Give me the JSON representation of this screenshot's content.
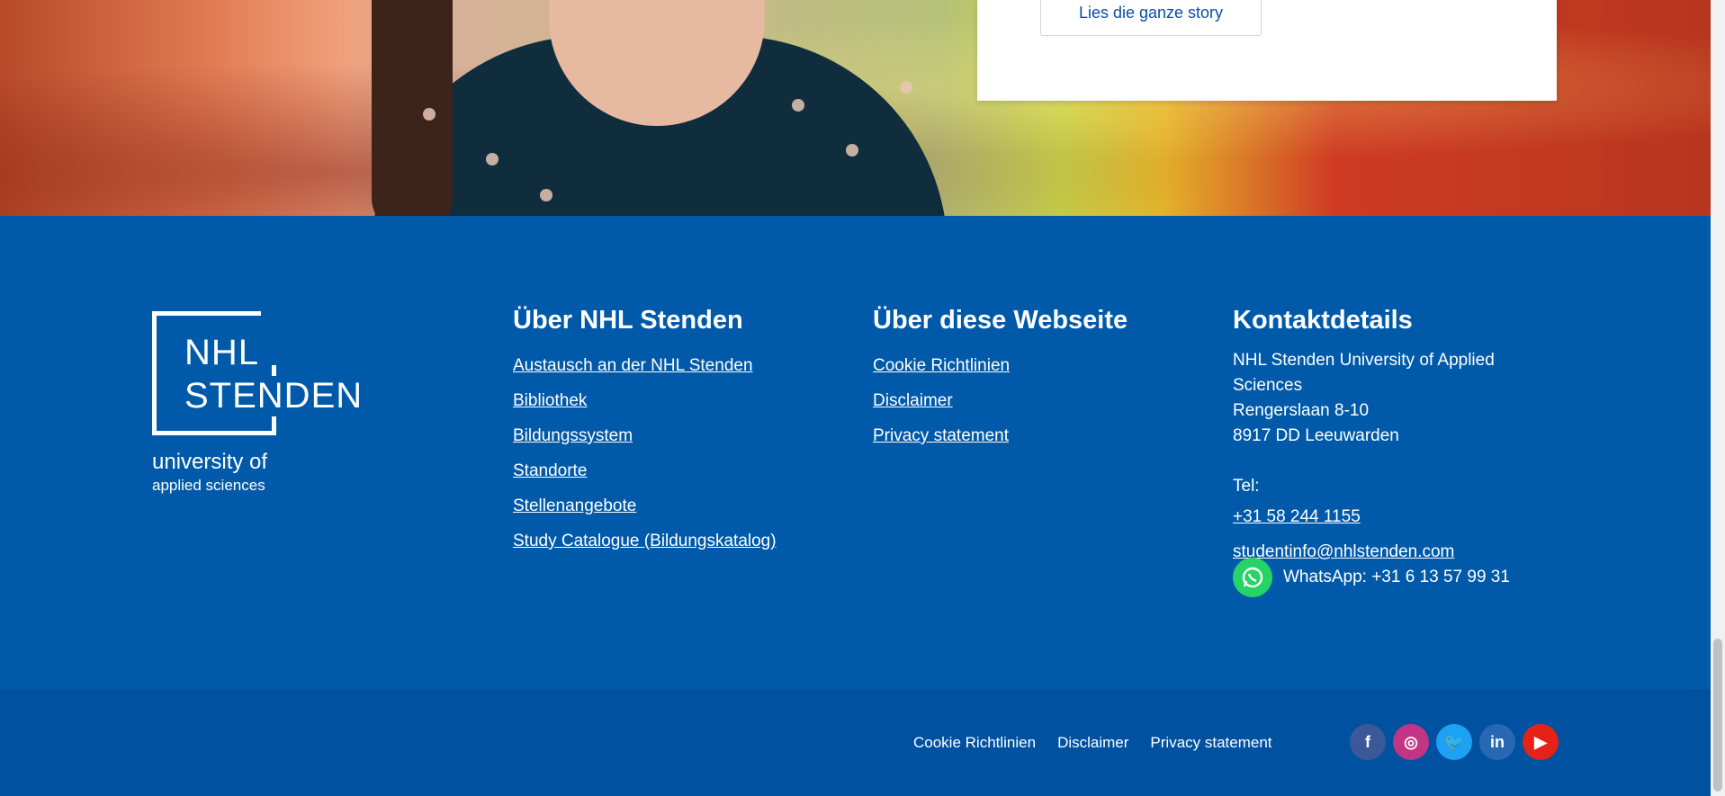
{
  "hero": {
    "story_button": "Lies die ganze story"
  },
  "logo": {
    "line1": "NHL",
    "line2": "STENDEN",
    "line3": "university of",
    "line4": "applied sciences"
  },
  "about": {
    "title": "Über NHL Stenden",
    "links": [
      "Austausch an der NHL Stenden",
      "Bibliothek",
      "Bildungssystem",
      "Standorte",
      "Stellenangebote",
      "Study Catalogue (Bildungskatalog)"
    ]
  },
  "site": {
    "title": "Über diese Webseite",
    "links": [
      "Cookie Richtlinien",
      "Disclaimer",
      "Privacy statement"
    ]
  },
  "contact": {
    "title": "Kontaktdetails",
    "org": "NHL Stenden University of Applied Sciences",
    "street": "Rengerslaan 8-10",
    "city": "8917 DD Leeuwarden",
    "tel_label": "Tel: ",
    "tel": "+31 58 244 1155",
    "email": "studentinfo@nhlstenden.com ",
    "whatsapp": "WhatsApp: +31 6 13 57 99 31"
  },
  "bottom": {
    "links": [
      "Cookie Richtlinien",
      "Disclaimer",
      "Privacy statement"
    ]
  },
  "social": [
    {
      "icon": "facebook-icon",
      "glyph": "f",
      "color": "#3b5998"
    },
    {
      "icon": "instagram-icon",
      "glyph": "◎",
      "color": "#c13584"
    },
    {
      "icon": "twitter-icon",
      "glyph": "🐦",
      "color": "#1da1f2"
    },
    {
      "icon": "linkedin-icon",
      "glyph": "in",
      "color": "#2867b2"
    },
    {
      "icon": "youtube-icon",
      "glyph": "▶",
      "color": "#e62117"
    }
  ],
  "colors": {
    "footer_blue": "#005aa9",
    "bottom_blue": "#0052a0",
    "whatsapp_green": "#25d366"
  }
}
